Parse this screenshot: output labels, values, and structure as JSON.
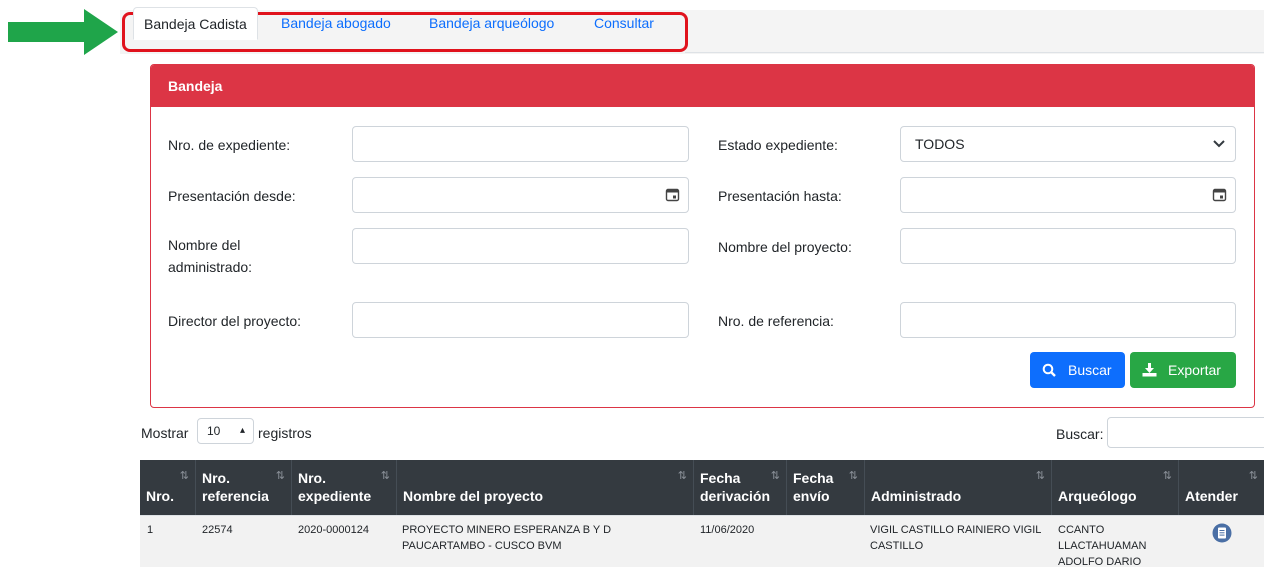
{
  "tabs": [
    {
      "label": "Bandeja Cadista",
      "active": true
    },
    {
      "label": "Bandeja abogado",
      "active": false
    },
    {
      "label": "Bandeja arqueólogo",
      "active": false
    },
    {
      "label": "Consultar",
      "active": false
    }
  ],
  "card": {
    "title": "Bandeja",
    "accent_color": "#dc3545",
    "fields": {
      "nro_expediente": {
        "label": "Nro. de expediente:",
        "value": ""
      },
      "estado": {
        "label": "Estado expediente:",
        "value": "TODOS"
      },
      "desde": {
        "label": "Presentación desde:",
        "value": ""
      },
      "hasta": {
        "label": "Presentación hasta:",
        "value": ""
      },
      "administrado": {
        "label_line1": "Nombre del",
        "label_line2": "administrado:",
        "value": ""
      },
      "proyecto": {
        "label": "Nombre del proyecto:",
        "value": ""
      },
      "director": {
        "label": "Director del proyecto:",
        "value": ""
      },
      "referencia": {
        "label": "Nro. de referencia:",
        "value": ""
      }
    },
    "buttons": {
      "buscar": "Buscar",
      "exportar": "Exportar"
    }
  },
  "length": {
    "prefix": "Mostrar",
    "value": "10",
    "suffix": "registros"
  },
  "search": {
    "label": "Buscar:",
    "value": ""
  },
  "table": {
    "columns": [
      {
        "l1": "",
        "l2": "Nro."
      },
      {
        "l1": "Nro.",
        "l2": "referencia"
      },
      {
        "l1": "Nro.",
        "l2": "expediente"
      },
      {
        "l1": "",
        "l2": "Nombre del proyecto"
      },
      {
        "l1": "Fecha",
        "l2": "derivación"
      },
      {
        "l1": "Fecha",
        "l2": "envío"
      },
      {
        "l1": "",
        "l2": "Administrado"
      },
      {
        "l1": "",
        "l2": "Arqueólogo"
      },
      {
        "l1": "",
        "l2": "Atender"
      }
    ],
    "rows": [
      {
        "nro": "1",
        "referencia": "22574",
        "expediente": "2020-0000124",
        "proyecto_l1": "PROYECTO MINERO ESPERANZA B Y D",
        "proyecto_l2": "PAUCARTAMBO - CUSCO BVM",
        "fecha_derivacion": "11/06/2020",
        "fecha_envio": "",
        "administrado_l1": "VIGIL CASTILLO RAINIERO VIGIL",
        "administrado_l2": "CASTILLO",
        "arqueologo_l1": "CCANTO",
        "arqueologo_l2": "LLACTAHUAMAN",
        "arqueologo_l3": "ADOLFO DARIO"
      }
    ]
  }
}
